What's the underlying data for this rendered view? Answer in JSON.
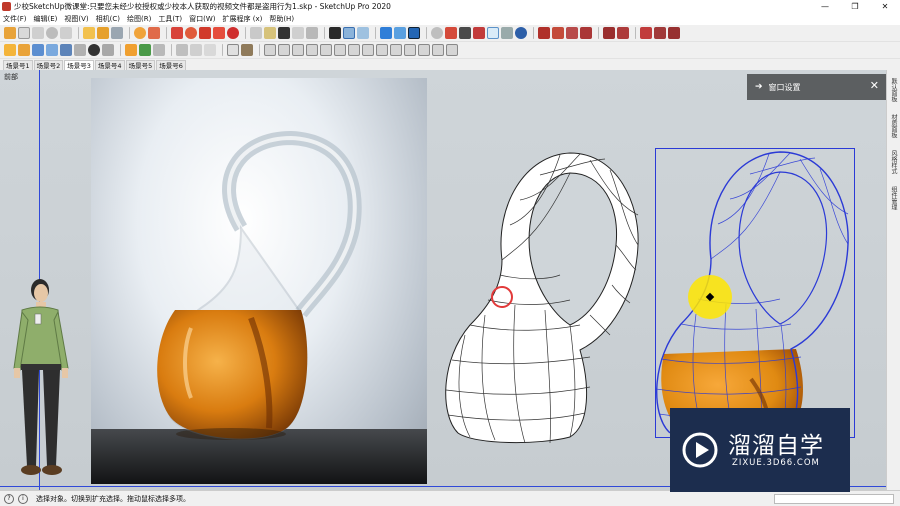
{
  "window": {
    "title": "少校SketchUp微课堂:只要您未经少校授权或少校本人获取的视频文件都是盗用行为1.skp - SketchUp Pro 2020",
    "minimize": "—",
    "maximize": "❐",
    "close": "✕"
  },
  "menu": [
    "文件(F)",
    "编辑(E)",
    "视图(V)",
    "相机(C)",
    "绘图(R)",
    "工具(T)",
    "窗口(W)",
    "扩展程序 (x)",
    "帮助(H)"
  ],
  "scene_tabs": [
    "场景号1",
    "场景号2",
    "场景号3",
    "场景号4",
    "场景号5",
    "场景号6"
  ],
  "active_scene_index": 2,
  "viewport": {
    "camera_label": "前部"
  },
  "tray_panel": {
    "title": "窗口设置",
    "arrow": "➔",
    "close": "✕"
  },
  "sidebar_tabs": [
    "默认面板",
    "材质面板",
    "风格样式",
    "组件管理"
  ],
  "status": {
    "help_icon": "?",
    "info_icon": "i",
    "text": "选择对象。切换到扩充选择。拖动鼠标选择多项。"
  },
  "watermark": {
    "brand": "溜溜自学",
    "url": "ZIXUE.3D66.COM"
  },
  "colors": {
    "axis_blue": "#2f49d8",
    "selection_blue": "#2b3ad6",
    "liquid_orange": "#e08a12",
    "highlight_yellow": "#ffe600",
    "panel_header": "#5c5f61",
    "watermark_bg": "#1c2d4e"
  }
}
